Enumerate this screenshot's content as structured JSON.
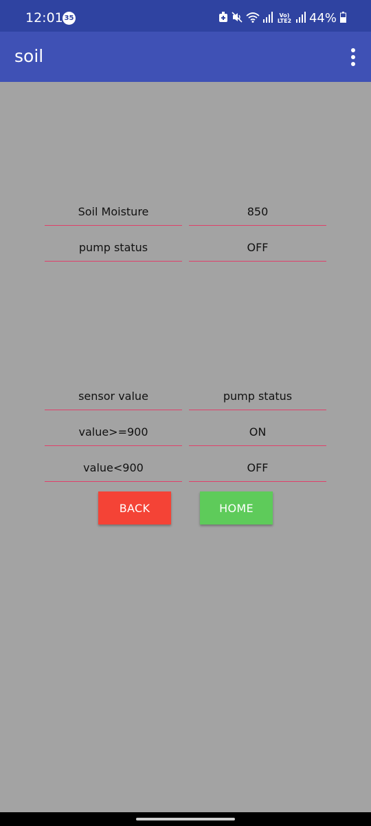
{
  "status_bar": {
    "time": "12:01",
    "notification_count": "35",
    "lte_label": "Vo) LTE2",
    "battery": "44%",
    "icons": [
      "alarm-icon",
      "mute-icon",
      "wifi-icon",
      "signal-icon",
      "lte-icon",
      "signal-icon",
      "battery-icon"
    ]
  },
  "app_bar": {
    "title": "soil",
    "menu_icon": "overflow-menu-icon"
  },
  "readings": {
    "moisture_label": "Soil Moisture",
    "moisture_value": "850",
    "pump_label": "pump status",
    "pump_value": "OFF"
  },
  "rules_table": {
    "header_sensor": "sensor value",
    "header_pump": "pump status",
    "rows": [
      {
        "condition": "value>=900",
        "pump": "ON"
      },
      {
        "condition": "value<900",
        "pump": "OFF"
      }
    ]
  },
  "buttons": {
    "back_label": "BACK",
    "back_color": "#f44336",
    "home_label": "HOME",
    "home_color": "#5ecb5a"
  },
  "colors": {
    "status_bar": "#2f43a1",
    "app_bar": "#3f51b5",
    "background": "#a3a3a3",
    "field_underline": "#e0406a"
  }
}
